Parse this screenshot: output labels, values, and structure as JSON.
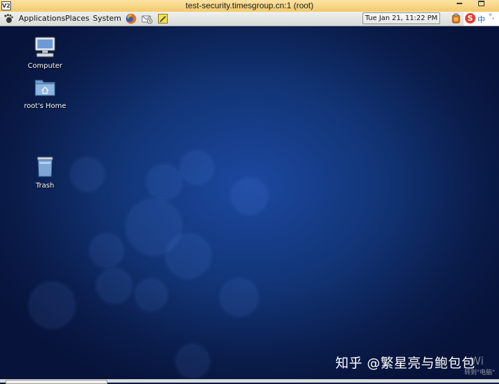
{
  "window": {
    "title": "test-security.timesgroup.cn:1 (root)",
    "app_icon": "V2"
  },
  "panel": {
    "menus": [
      "Applications",
      "Places",
      "System"
    ],
    "launchers": [
      "firefox-icon",
      "mail-icon",
      "notes-icon"
    ],
    "clock": "Tue Jan 21, 11:22 PM",
    "ime": {
      "logo": "S",
      "lang": "中",
      "extra": "°,"
    }
  },
  "desktop": {
    "icons": [
      {
        "label": "Computer",
        "icon": "computer-icon"
      },
      {
        "label": "root's Home",
        "icon": "home-folder-icon"
      },
      {
        "label": "Trash",
        "icon": "trash-icon"
      }
    ]
  },
  "watermark": {
    "text": "知乎 @繁星亮与鲍包包",
    "suffix": "Wi",
    "sub": "转到\"电脑\""
  },
  "colors": {
    "panel": "#e4e6e4",
    "desktop": "#123577",
    "titlebar": "#f2c96c"
  }
}
